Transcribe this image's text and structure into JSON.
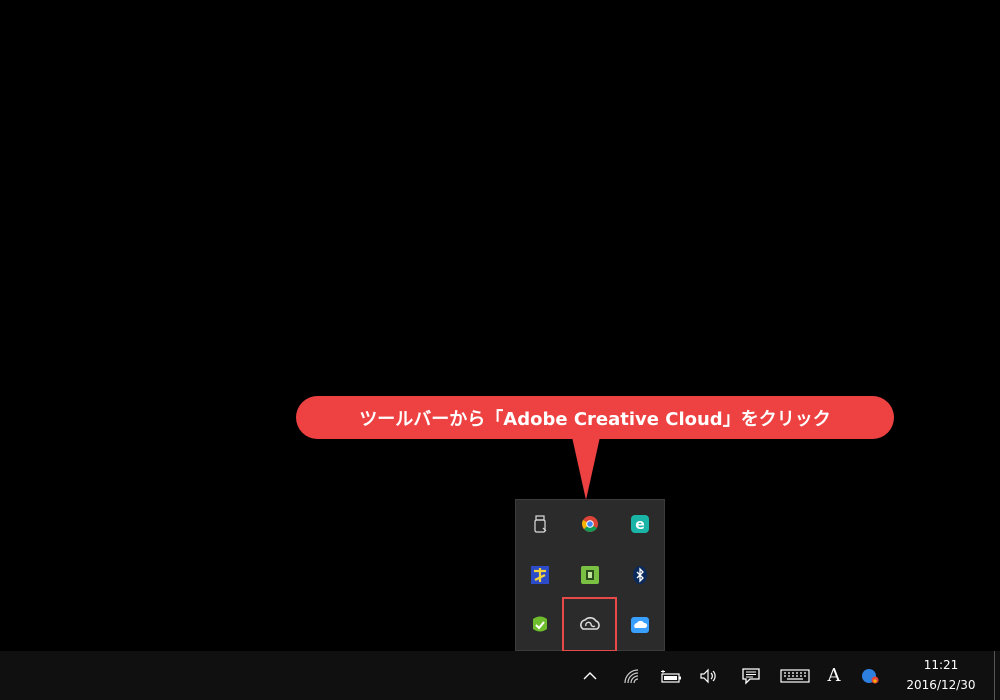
{
  "callout": {
    "text": "ツールバーから「Adobe Creative Cloud」をクリック",
    "color": "#ee4242"
  },
  "tray_flyout": {
    "icons": [
      {
        "name": "usb-eject-icon"
      },
      {
        "name": "chrome-icon"
      },
      {
        "name": "eset-icon"
      },
      {
        "name": "hidemaru-icon"
      },
      {
        "name": "evernote-icon"
      },
      {
        "name": "bluetooth-icon"
      },
      {
        "name": "line-icon"
      },
      {
        "name": "creative-cloud-icon"
      },
      {
        "name": "icloud-icon"
      }
    ],
    "highlighted": "creative-cloud-icon"
  },
  "taskbar": {
    "ime_label": "A",
    "clock_time": "11:21",
    "clock_date": "2016/12/30"
  }
}
